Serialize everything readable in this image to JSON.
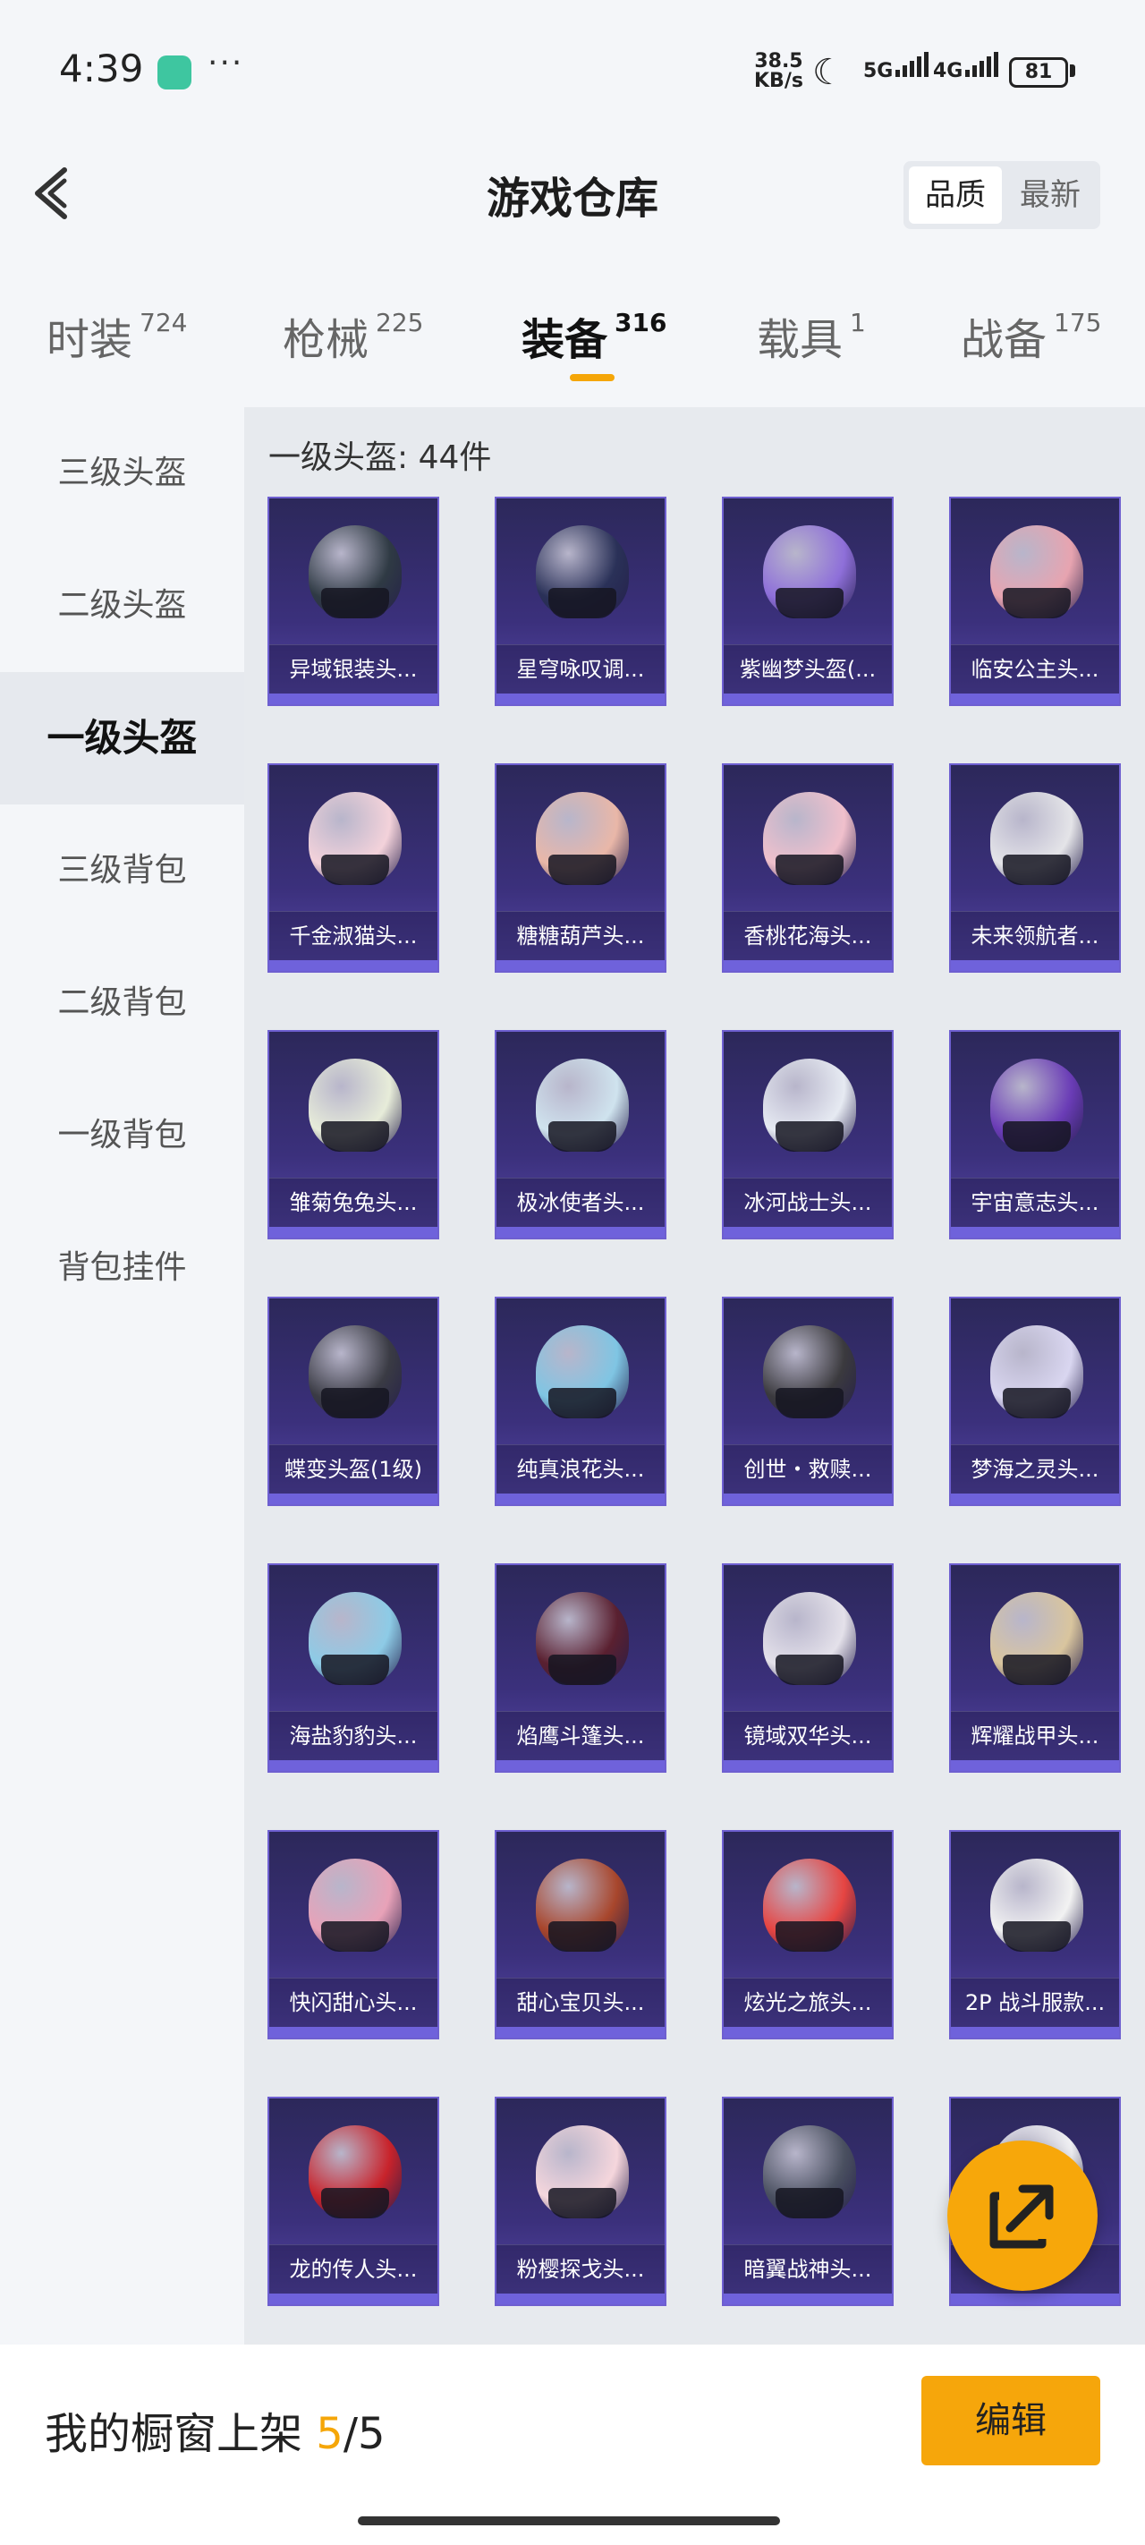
{
  "status_bar": {
    "time": "4:39",
    "dots": "···",
    "net_speed_value": "38.5",
    "net_speed_unit": "KB/s",
    "signal_1": "5G",
    "signal_2": "4G",
    "battery": "81"
  },
  "header": {
    "title": "游戏仓库",
    "sort_options": [
      "品质",
      "最新"
    ],
    "sort_selected": "品质"
  },
  "tabs": [
    {
      "label": "时装",
      "count": "724"
    },
    {
      "label": "枪械",
      "count": "225"
    },
    {
      "label": "装备",
      "count": "316"
    },
    {
      "label": "载具",
      "count": "1"
    },
    {
      "label": "战备",
      "count": "175"
    }
  ],
  "active_tab": "装备",
  "accent_color": "#f5a608",
  "sidebar": {
    "items": [
      {
        "label": "三级头盔"
      },
      {
        "label": "二级头盔"
      },
      {
        "label": "一级头盔"
      },
      {
        "label": "三级背包"
      },
      {
        "label": "二级背包"
      },
      {
        "label": "一级背包"
      },
      {
        "label": "背包挂件"
      }
    ],
    "active": "一级头盔"
  },
  "section": {
    "title": "一级头盔: 44件"
  },
  "items": [
    {
      "name": "异域银装头...",
      "color": "#2f3a44"
    },
    {
      "name": "星穹咏叹调...",
      "color": "#2a3158"
    },
    {
      "name": "紫幽梦头盔(...",
      "color": "#8e6fd9"
    },
    {
      "name": "临安公主头...",
      "color": "#e7a4b0"
    },
    {
      "name": "千金淑猫头...",
      "color": "#f3d2da"
    },
    {
      "name": "糖糖葫芦头...",
      "color": "#e9b7a8"
    },
    {
      "name": "香桃花海头...",
      "color": "#f0c0cc"
    },
    {
      "name": "未来领航者...",
      "color": "#e4e4e8"
    },
    {
      "name": "雏菊兔兔头...",
      "color": "#e7ecd9"
    },
    {
      "name": "极冰使者头...",
      "color": "#cfe3ee"
    },
    {
      "name": "冰河战士头...",
      "color": "#e6eaf2"
    },
    {
      "name": "宇宙意志头...",
      "color": "#6a3cb6"
    },
    {
      "name": "蝶变头盔(1级)",
      "color": "#3a3b44"
    },
    {
      "name": "纯真浪花头...",
      "color": "#7fc5e3"
    },
    {
      "name": "创世・救赎...",
      "color": "#3b3a3e"
    },
    {
      "name": "梦海之灵头...",
      "color": "#d9d6f0"
    },
    {
      "name": "海盐豹豹头...",
      "color": "#8dcbe6"
    },
    {
      "name": "焰鹰斗篷头...",
      "color": "#5a2030"
    },
    {
      "name": "镜域双华头...",
      "color": "#e4e1ea"
    },
    {
      "name": "辉耀战甲头...",
      "color": "#d9c59e"
    },
    {
      "name": "快闪甜心头...",
      "color": "#e8a2b8"
    },
    {
      "name": "甜心宝贝头...",
      "color": "#a8462c"
    },
    {
      "name": "炫光之旅头...",
      "color": "#e64542"
    },
    {
      "name": "2P 战斗服款...",
      "color": "#f2f2f2"
    },
    {
      "name": "龙的传人头...",
      "color": "#c8232b"
    },
    {
      "name": "粉樱探戈头...",
      "color": "#f5d6dc"
    },
    {
      "name": "暗翼战神头...",
      "color": "#4a5060"
    },
    {
      "name": "",
      "color": "#f0f0f3"
    }
  ],
  "bottom_bar": {
    "label": "我的橱窗上架",
    "current": "5",
    "total": "/5",
    "edit_label": "编辑"
  }
}
